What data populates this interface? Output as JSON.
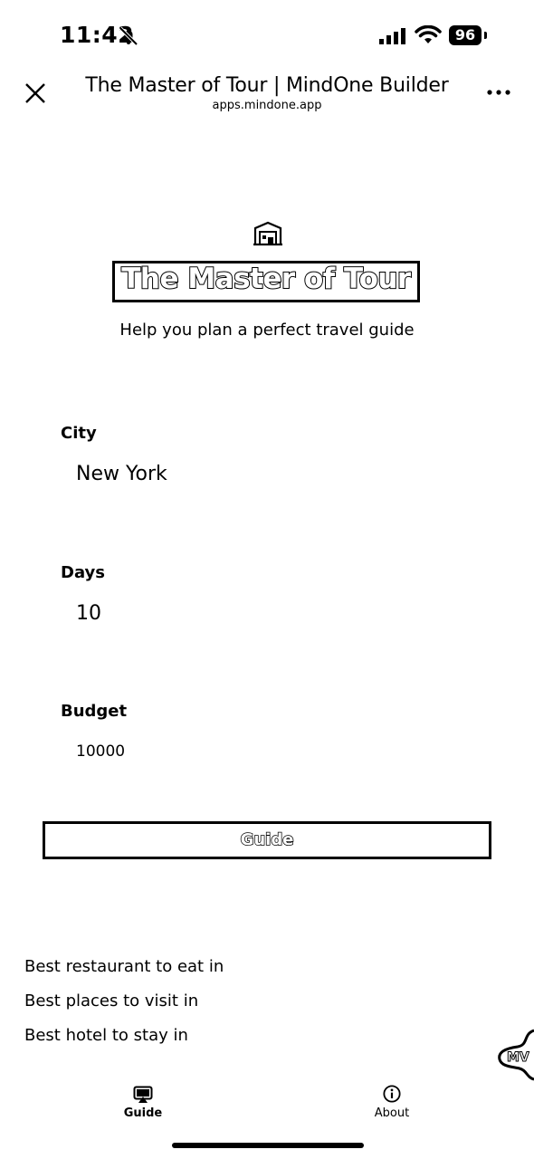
{
  "status_bar": {
    "time": "11:42",
    "battery": "96",
    "icons": [
      "bell-slash-icon",
      "cellular-signal-icon",
      "wifi-icon",
      "battery-icon"
    ]
  },
  "header": {
    "title": "The Master of Tour | MindOne Builder",
    "url": "apps.mindone.app",
    "icons": [
      "close-icon",
      "more-icon"
    ]
  },
  "app": {
    "title": "The Master of Tour",
    "tagline": "Help you plan a perfect travel guide",
    "icon": "building-icon"
  },
  "form": {
    "city": {
      "label": "City",
      "value": "New York"
    },
    "days": {
      "label": "Days",
      "value": "10"
    },
    "budget": {
      "label": "Budget",
      "value": "10000"
    },
    "submit_label": "Guide"
  },
  "suggestions": [
    "Best restaurant to eat in",
    "Best places to visit in",
    "Best hotel to stay in"
  ],
  "bottom_nav": [
    {
      "label": "Guide",
      "icon": "airplay-icon",
      "active": true
    },
    {
      "label": "About",
      "icon": "info-icon",
      "active": false
    }
  ]
}
